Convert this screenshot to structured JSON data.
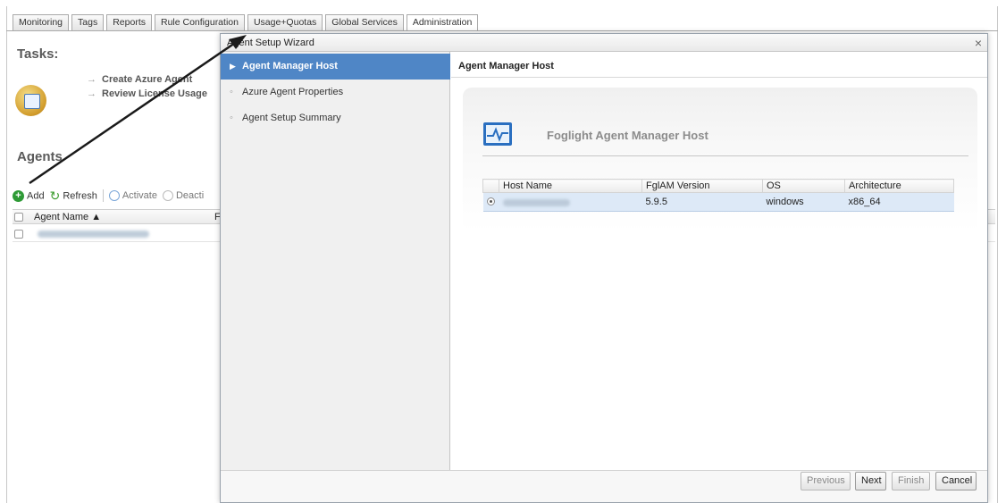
{
  "tabs": [
    "Monitoring",
    "Tags",
    "Reports",
    "Rule Configuration",
    "Usage+Quotas",
    "Global Services",
    "Administration"
  ],
  "active_tab": "Administration",
  "admin": {
    "tasks_heading": "Tasks:",
    "tasks": [
      "Create Azure Agent",
      "Review License Usage"
    ],
    "agents_heading": "Agents",
    "toolbar": {
      "add": "Add",
      "refresh": "Refresh",
      "activate": "Activate",
      "deactivate": "Deacti"
    },
    "grid": {
      "col_agent_name": "Agent Name ▲",
      "col_next": "F"
    }
  },
  "wizard": {
    "title": "Agent Setup Wizard",
    "close": "×",
    "steps": [
      {
        "label": "Agent Manager Host",
        "marker": "▶"
      },
      {
        "label": "Azure Agent Properties",
        "marker": "◦"
      },
      {
        "label": "Agent Setup Summary",
        "marker": "◦"
      }
    ],
    "content_title": "Agent Manager Host",
    "panel_title": "Foglight Agent Manager Host",
    "table": {
      "headers": [
        "",
        "Host Name",
        "FglAM Version",
        "OS",
        "Architecture"
      ],
      "rows": [
        {
          "version": "5.9.5",
          "os": "windows",
          "arch": "x86_64"
        }
      ]
    },
    "buttons": {
      "previous": "Previous",
      "next": "Next",
      "finish": "Finish",
      "cancel": "Cancel"
    }
  },
  "colors": {
    "accent": "#4f86c6",
    "selected_row": "#dde9f7"
  },
  "icons": [
    "add-icon",
    "refresh-icon",
    "power-icon",
    "tasks-icon",
    "host-monitor-icon",
    "close-icon"
  ]
}
